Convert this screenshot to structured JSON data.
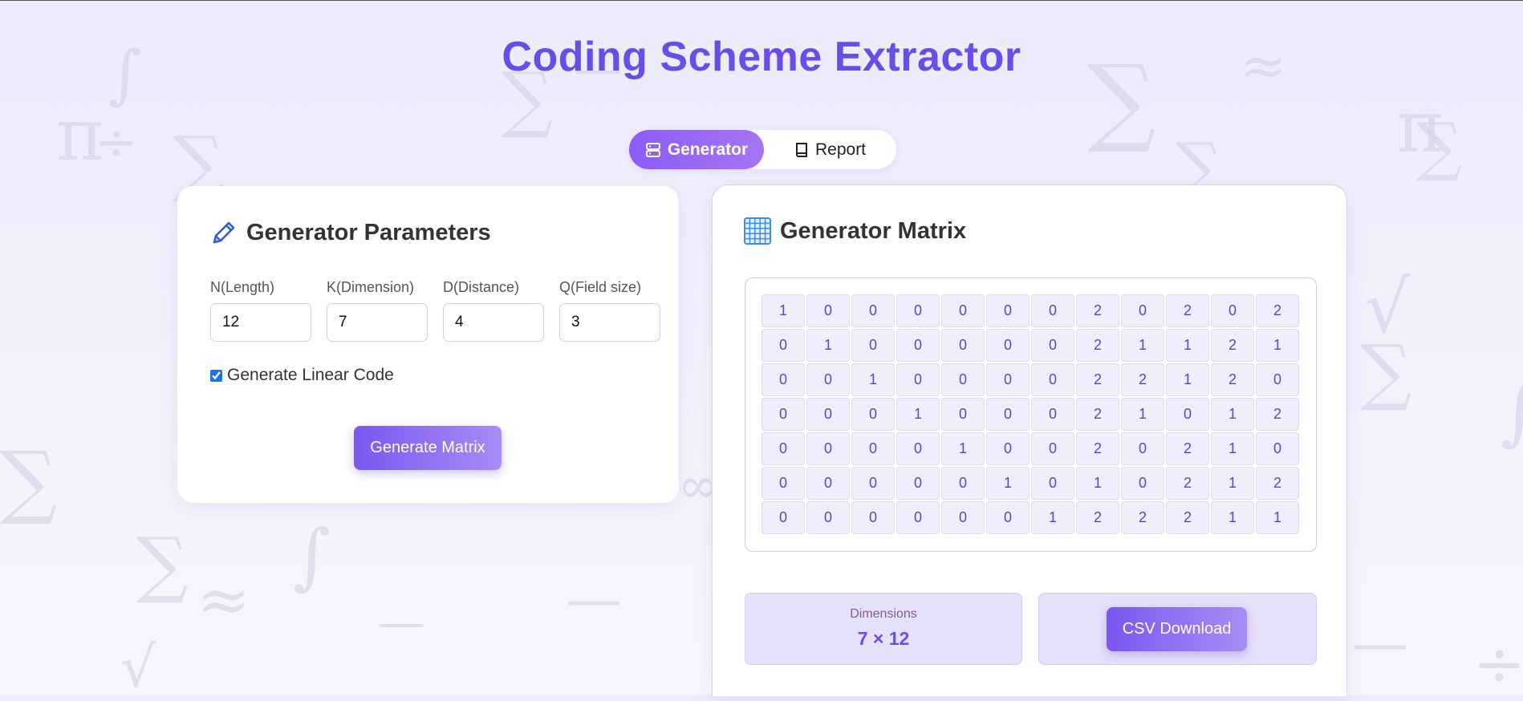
{
  "app": {
    "title": "Coding Scheme Extractor"
  },
  "tabs": [
    {
      "label": "Generator",
      "icon": "server-icon",
      "active": true
    },
    {
      "label": "Report",
      "icon": "book-icon",
      "active": false
    }
  ],
  "parameters": {
    "title": "Generator Parameters",
    "icon": "pencil-icon",
    "fields": [
      {
        "label": "N(Length)",
        "value": "12"
      },
      {
        "label": "K(Dimension)",
        "value": "7"
      },
      {
        "label": "D(Distance)",
        "value": "4"
      },
      {
        "label": "Q(Field size)",
        "value": "3"
      }
    ],
    "checkbox": {
      "label": "Generate Linear Code",
      "checked": true
    },
    "generate_label": "Generate Matrix"
  },
  "matrix": {
    "title": "Generator Matrix",
    "icon": "grid-icon",
    "rows": [
      [
        1,
        0,
        0,
        0,
        0,
        0,
        0,
        2,
        0,
        2,
        0,
        2
      ],
      [
        0,
        1,
        0,
        0,
        0,
        0,
        0,
        2,
        1,
        1,
        2,
        1
      ],
      [
        0,
        0,
        1,
        0,
        0,
        0,
        0,
        2,
        2,
        1,
        2,
        0
      ],
      [
        0,
        0,
        0,
        1,
        0,
        0,
        0,
        2,
        1,
        0,
        1,
        2
      ],
      [
        0,
        0,
        0,
        0,
        1,
        0,
        0,
        2,
        0,
        2,
        1,
        0
      ],
      [
        0,
        0,
        0,
        0,
        0,
        1,
        0,
        1,
        0,
        2,
        1,
        2
      ],
      [
        0,
        0,
        0,
        0,
        0,
        0,
        1,
        2,
        2,
        2,
        1,
        1
      ]
    ],
    "dimensions_label": "Dimensions",
    "dimensions_value": "7 × 12",
    "csv_label": "CSV Download"
  },
  "colors": {
    "accent": "#6a4ce8",
    "tab_active": "#8b5cf6",
    "cell_bg": "#f0eefc",
    "info_bg": "#e6e1fb"
  }
}
